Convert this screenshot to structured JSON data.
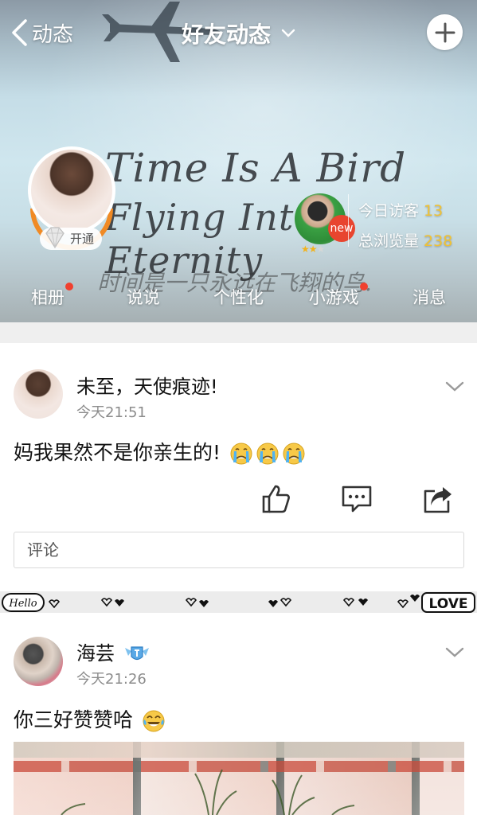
{
  "header": {
    "back_label": "动态",
    "title": "好友动态",
    "cover_script_line1": "Time Is A Bird",
    "cover_script_line2": "Flying Into Eternity",
    "cover_script_chinese": "时间是一只永远在飞翔的鸟.",
    "vip_label": "开通",
    "new_badge": "new",
    "visitor_level_stars": 2,
    "visitor_level_max": 3,
    "stats": [
      {
        "label": "今日访客",
        "value": "13"
      },
      {
        "label": "总浏览量",
        "value": "238"
      }
    ],
    "nav": [
      {
        "label": "相册",
        "has_dot": true
      },
      {
        "label": "说说",
        "has_dot": false
      },
      {
        "label": "个性化",
        "has_dot": false
      },
      {
        "label": "小游戏",
        "has_dot": true
      },
      {
        "label": "消息",
        "has_dot": false
      }
    ],
    "icons": {
      "back": "chevron-left-icon",
      "title_dropdown": "chevron-down-icon",
      "add": "plus-icon",
      "vip": "diamond-icon"
    }
  },
  "posts": [
    {
      "name": "未至，天使痕迹!",
      "time": "今天21:51",
      "text": "妈我果然不是你亲生的!",
      "emojis": [
        "crying-emoji",
        "crying-emoji",
        "crying-emoji"
      ],
      "actions": [
        "like-icon",
        "comment-icon",
        "share-icon"
      ],
      "comment_placeholder": "评论"
    },
    {
      "name": "海芸",
      "name_badge": "vip-badge-icon",
      "time": "今天21:26",
      "text": "你三好赞赞哈",
      "emojis": [
        "laughing-tears-emoji"
      ]
    }
  ],
  "decoration": {
    "left_tag": "Hello",
    "right_tag": "LOVE"
  },
  "colors": {
    "accent_orange": "#f08a24",
    "badge_red": "#e8452f",
    "dot_red": "#f0402f",
    "stat_number": "#f1c232",
    "time_gray": "#8c8c8c"
  }
}
